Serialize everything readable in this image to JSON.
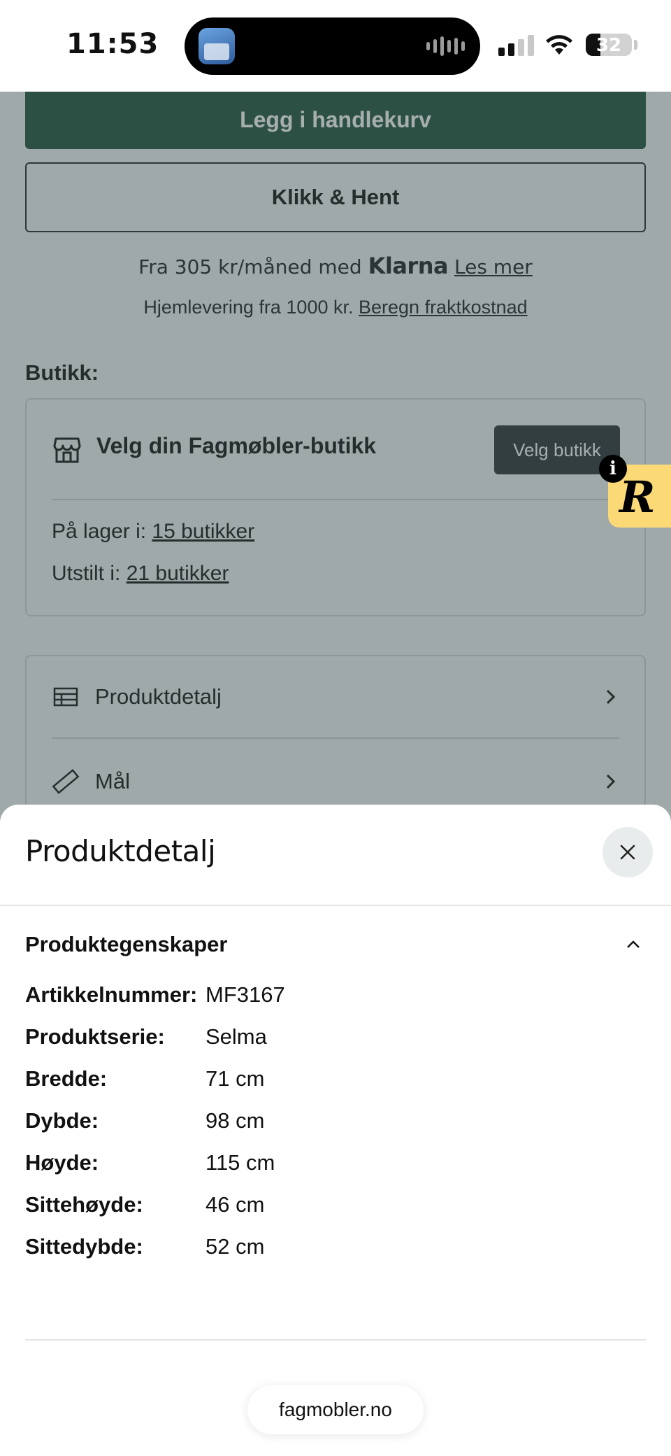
{
  "status_bar": {
    "time": "11:53",
    "battery": "32"
  },
  "page": {
    "add_to_cart_label": "Legg i handlekurv",
    "click_collect_label": "Klikk & Hent",
    "klarna": {
      "prefix": "Fra 305 kr/måned med",
      "logo": "Klarna",
      "link": "Les mer"
    },
    "shipping": {
      "text": "Hjemlevering fra 1000 kr.",
      "link": "Beregn fraktkostnad"
    },
    "store_section_label": "Butikk:",
    "store": {
      "title": "Velg din Fagmøbler-butikk",
      "button": "Velg butikk",
      "stock_prefix": "På lager i:",
      "stock_link": "15 butikker",
      "shown_prefix": "Utstilt i:",
      "shown_link": "21 butikker"
    },
    "accordion": [
      {
        "label": "Produktdetalj",
        "icon": "table-icon"
      },
      {
        "label": "Mål",
        "icon": "ruler-icon"
      }
    ]
  },
  "sheet": {
    "title": "Produktdetalj",
    "section_title": "Produktegenskaper",
    "properties": [
      {
        "label": "Artikkelnummer:",
        "value": "MF3167"
      },
      {
        "label": "Produktserie:",
        "value": "Selma"
      },
      {
        "label": "Bredde:",
        "value": "71 cm"
      },
      {
        "label": "Dybde:",
        "value": "98 cm"
      },
      {
        "label": "Høyde:",
        "value": "115 cm"
      },
      {
        "label": "Sittehøyde:",
        "value": "46 cm"
      },
      {
        "label": "Sittedybde:",
        "value": "52 cm"
      }
    ]
  },
  "browser": {
    "url": "fagmobler.no"
  },
  "colors": {
    "primary_green": "#2f5e4a",
    "dark_button": "#3a3f42",
    "badge_yellow": "#fcd977"
  }
}
